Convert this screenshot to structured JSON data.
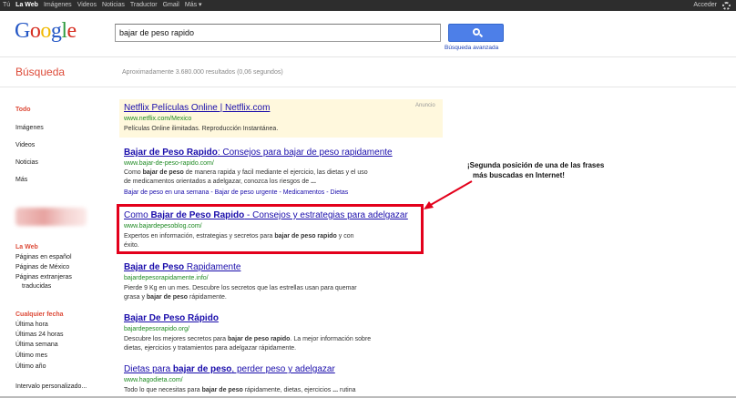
{
  "topbar": {
    "nav": [
      "Tú",
      "La Web",
      "Imágenes",
      "Videos",
      "Noticias",
      "Traductor",
      "Gmail",
      "Más ▾"
    ],
    "signin": "Acceder"
  },
  "logo": "Google",
  "search": {
    "query": "bajar de peso rapido",
    "advanced": "Búsqueda avanzada"
  },
  "section_title": "Búsqueda",
  "stats": "Aproximadamente 3.680.000 resultados (0,06 segundos)",
  "sidebar": {
    "types": [
      "Todo",
      "Imágenes",
      "Videos",
      "Noticias",
      "Más"
    ],
    "web_heading": "La Web",
    "web_items": [
      "Páginas en español",
      "Páginas de México",
      "Páginas extranjeras",
      "traducidas"
    ],
    "date_heading": "Cualquier fecha",
    "date_items": [
      "Última hora",
      "Últimas 24 horas",
      "Última semana",
      "Último mes",
      "Último año",
      "Intervalo personalizado..."
    ]
  },
  "ad": {
    "label": "Anuncio",
    "title": "Netflix Películas Online | Netflix.com",
    "url": "www.netflix.com/Mexico",
    "snippet": "Películas Online ilimitadas. Reproducción Instantánea."
  },
  "results": [
    {
      "title_bold": "Bajar de Peso Rapido",
      "title_rest": ": Consejos para bajar de peso rapidamente",
      "url": "www.bajar-de-peso-rapido.com/",
      "line1": [
        "Como ",
        "bajar de peso",
        " de manera rapida y facil mediante el ejercicio, las dietas y el uso"
      ],
      "line2": [
        "de medicamentos orientados a adelgazar, conozca los riesgos de ",
        "...",
        ""
      ],
      "links": "Bajar de peso en una semana - Bajar de peso urgente - Medicamentos - Dietas"
    },
    {
      "title_pre": "Como ",
      "title_bold": "Bajar de Peso Rapido",
      "title_rest": " - Consejos y estrategias para adelgazar",
      "url": "www.bajardepesoblog.com/",
      "line1": [
        "Expertos en información, estrategias y secretos para ",
        "bajar de peso rapido",
        " y con"
      ],
      "line2": "éxito."
    },
    {
      "title_bold": "Bajar de Peso",
      "title_rest": " Rapidamente",
      "url": "bajardepesorapidamente.info/",
      "line1": "Pierde 9 Kg en un mes. Descubre los secretos que las estrellas usan para quemar",
      "line2": [
        "grasa y ",
        "bajar de peso",
        " rápidamente."
      ]
    },
    {
      "title_bold": "Bajar De Peso Rápido",
      "url": "bajardepesorapido.org/",
      "line1": [
        "Descubre los mejores secretos para ",
        "bajar de peso rapido",
        ". La mejor información sobre"
      ],
      "line2": "dietas, ejercicios y tratamientos para adelgazar rápidamente."
    },
    {
      "title_pre": "Dietas para ",
      "title_bold": "bajar de peso",
      "title_rest": ", perder peso y adelgazar",
      "url": "www.hagodieta.com/",
      "line1": [
        "Todo lo que necesitas para ",
        "bajar de peso",
        " rápidamente, dietas, ejercicios ",
        "...",
        " rutina"
      ]
    }
  ],
  "annotation": [
    "¡Segunda posición de una de las frases",
    "más buscadas en Internet!"
  ],
  "colors": {
    "accent_red": "#dd4b39",
    "link": "#1a0dab",
    "url_green": "#1e8a23",
    "highlight": "#e3001b",
    "ad_bg": "#fff8dd"
  }
}
